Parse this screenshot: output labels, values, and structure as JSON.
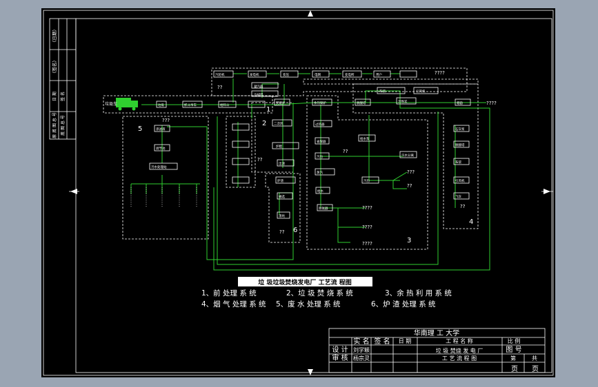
{
  "diagram": {
    "title": "垃 圾垃圾焚烧发电厂 工艺流 程图",
    "zone_numbers": [
      "1",
      "2",
      "3",
      "4",
      "5",
      "6"
    ],
    "nodes": {
      "truck": "垃圾车",
      "n_pit": "垃圾",
      "n_crane": "抓斗吊车",
      "n_hopper": "给料斗",
      "n_grate": "焚烧炉",
      "n_top1": "汽轮机",
      "n_top2": "发电机",
      "n_top3": "变压",
      "n_top4": "电网",
      "n_top5": "变电所",
      "n_top6": "用户",
      "n_sub1": "凝汽器",
      "n_sub2": "冷却塔",
      "n_z2_1": "二次风",
      "n_z2_2": "炉膛",
      "n_z2_3": "出渣",
      "n_z3_1": "余热锅炉",
      "n_z3_2": "过热器",
      "n_z3_3": "省煤器",
      "n_z3_4": "汽包",
      "n_z3_5": "蒸汽",
      "n_z3_6": "给水",
      "n_z3_7": "除氧器",
      "n_z3_8": "给水泵",
      "n_z3_9": "汽水分离",
      "n_z4_1": "脱酸塔",
      "n_z4_2": "布袋",
      "n_z4_3": "引风机",
      "n_z4_4": "烟囱",
      "n_z4_5": "活性炭",
      "n_z4_6": "石灰浆",
      "n_z4_7": "飞灰",
      "n_z5_1": "渗滤液",
      "n_z5_2": "调节池",
      "n_z5_3": "污水处理站",
      "n_z6_1": "炉渣",
      "n_z6_2": "磁选",
      "n_z6_3": "综合利用",
      "n_z6_4": "渣坑",
      "n_z6_5": "填埋",
      "n_z6_6": "制砖",
      "q": "????",
      "q2": "??",
      "q3": "???"
    },
    "legend": [
      "1、前 处理  系 统",
      "2、垃 圾 焚 烧 系 统",
      "3、余 热 利 用  系 统",
      "4、烟 气 处理  系 统",
      "5、废 水 处理  系 统",
      "6、炉 渣 处理  系 统"
    ]
  },
  "sidebar": {
    "cells": [
      "（日期）",
      "（签名）",
      "原 底 图 总 号",
      "底 图 总 号",
      "日 期",
      "签 名"
    ]
  },
  "title_block": {
    "school": "华南理 工 大学",
    "col_shi": "实 名",
    "col_sign": "签 名",
    "col_date": "日 期",
    "col_project": "工 程 名 称",
    "col_scale": "比 例",
    "row_design": "设 计",
    "designer": "刘学颖",
    "drawing_no": "图 号",
    "row_review": "审 核",
    "reviewer": "杨宗灵",
    "drawing_name_1": "垃 圾 焚烧 发 电 厂",
    "drawing_name_2": "工 艺 流 程 图",
    "sheet_di": "第",
    "sheet_gong": "共",
    "page_1": "页",
    "page_2": "页"
  },
  "colors": {
    "background": "#9aa5b3",
    "sheet": "#000000",
    "lines": "#ffffff",
    "flow": "#2fd02f"
  }
}
